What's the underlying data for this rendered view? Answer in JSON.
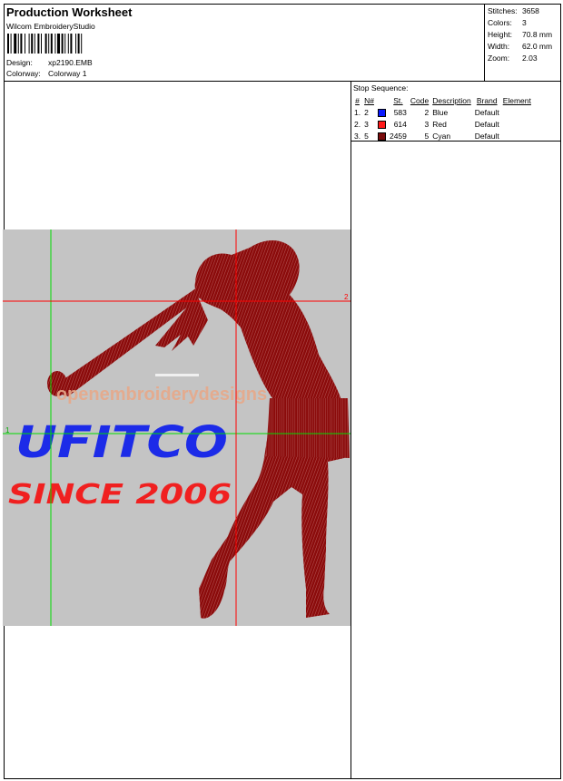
{
  "header": {
    "title": "Production Worksheet",
    "software": "Wilcom EmbroideryStudio",
    "design_label": "Design:",
    "design_value": "xp2190.EMB",
    "colorway_label": "Colorway:",
    "colorway_value": "Colorway 1"
  },
  "stats": [
    {
      "label": "Stitches:",
      "value": "3658"
    },
    {
      "label": "Colors:",
      "value": "3"
    },
    {
      "label": "Height:",
      "value": "70.8 mm"
    },
    {
      "label": "Width:",
      "value": "62.0 mm"
    },
    {
      "label": "Zoom:",
      "value": "2.03"
    }
  ],
  "stop_sequence": {
    "title": "Stop Sequence:",
    "columns": [
      "#",
      "N#",
      "St.",
      "Code",
      "Description",
      "Brand",
      "Element"
    ],
    "rows": [
      {
        "num": "1.",
        "needle": "2",
        "color": "#0a1aff",
        "stitches": "583",
        "code": "2",
        "description": "Blue",
        "brand": "Default",
        "element": ""
      },
      {
        "num": "2.",
        "needle": "3",
        "color": "#ff1a1a",
        "stitches": "614",
        "code": "3",
        "description": "Red",
        "brand": "Default",
        "element": ""
      },
      {
        "num": "3.",
        "needle": "5",
        "color": "#7a0c0c",
        "stitches": "2459",
        "code": "5",
        "description": "Cyan",
        "brand": "Default",
        "element": ""
      }
    ]
  },
  "design_preview": {
    "line1": "UFITCO",
    "line2": "SINCE 2006",
    "watermark": "openembroiderydesigns",
    "guide_label_h": "2",
    "guide_label_v": "1",
    "colors": {
      "background": "#c4c4c4",
      "figure": "#8b0b0b",
      "text_blue": "#1c2be8",
      "text_red": "#f02020",
      "guide_green": "#00dd00",
      "guide_red": "#ff0000",
      "watermark": "#e7a98a"
    }
  }
}
